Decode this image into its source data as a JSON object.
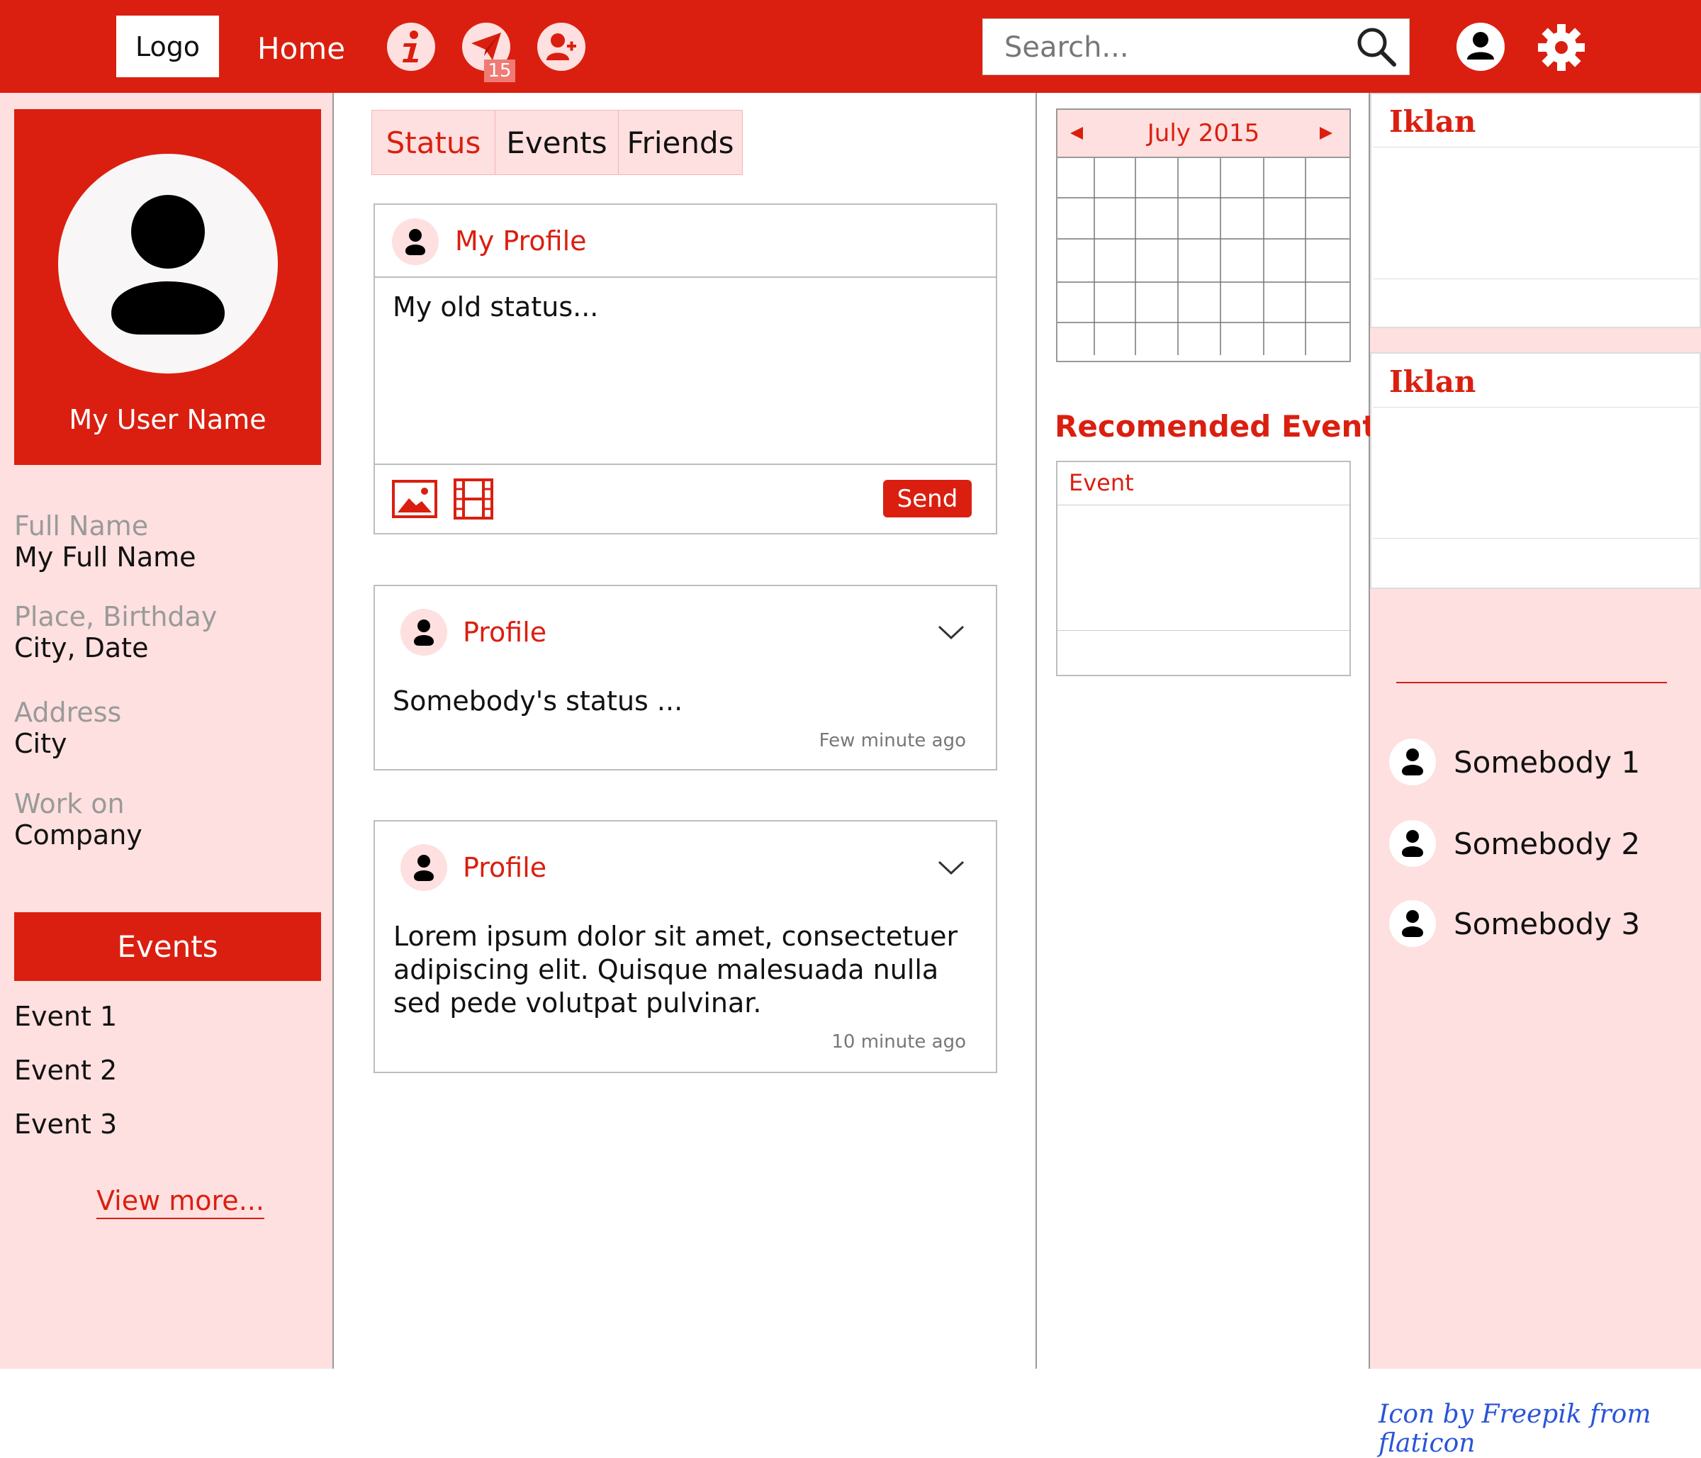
{
  "header": {
    "logo": "Logo",
    "home": "Home",
    "message_badge": "15",
    "search_placeholder": "Search..."
  },
  "profile": {
    "user_name": "My User Name",
    "fields": [
      {
        "label": "Full Name",
        "value": "My Full Name"
      },
      {
        "label": "Place, Birthday",
        "value": "City, Date"
      },
      {
        "label": "Address",
        "value": "City"
      },
      {
        "label": "Work on",
        "value": "Company"
      }
    ]
  },
  "events_panel": {
    "title": "Events",
    "items": [
      "Event 1",
      "Event 2",
      "Event 3"
    ],
    "view_more": "View more..."
  },
  "tabs": [
    "Status",
    "Events",
    "Friends"
  ],
  "compose": {
    "title": "My Profile",
    "status_text": "My old status...",
    "send": "Send"
  },
  "posts": [
    {
      "author": "Profile",
      "text": "Somebody's status ...",
      "time": "Few minute ago"
    },
    {
      "author": "Profile",
      "text": "Lorem ipsum dolor sit amet, consectetuer adipiscing elit. Quisque malesuada nulla sed pede volutpat pulvinar.",
      "time": "10 minute ago"
    }
  ],
  "calendar": {
    "month": "July 2015"
  },
  "recommended": {
    "title": "Recomended Event",
    "event_label": "Event"
  },
  "ads": [
    "Iklan",
    "Iklan"
  ],
  "friends": [
    "Somebody 1",
    "Somebody 2",
    "Somebody 3"
  ],
  "credit": "Icon by Freepik from flaticon",
  "colors": {
    "accent": "#da1f10",
    "panel_bg": "#fde0df",
    "credit": "#2a54d8"
  }
}
